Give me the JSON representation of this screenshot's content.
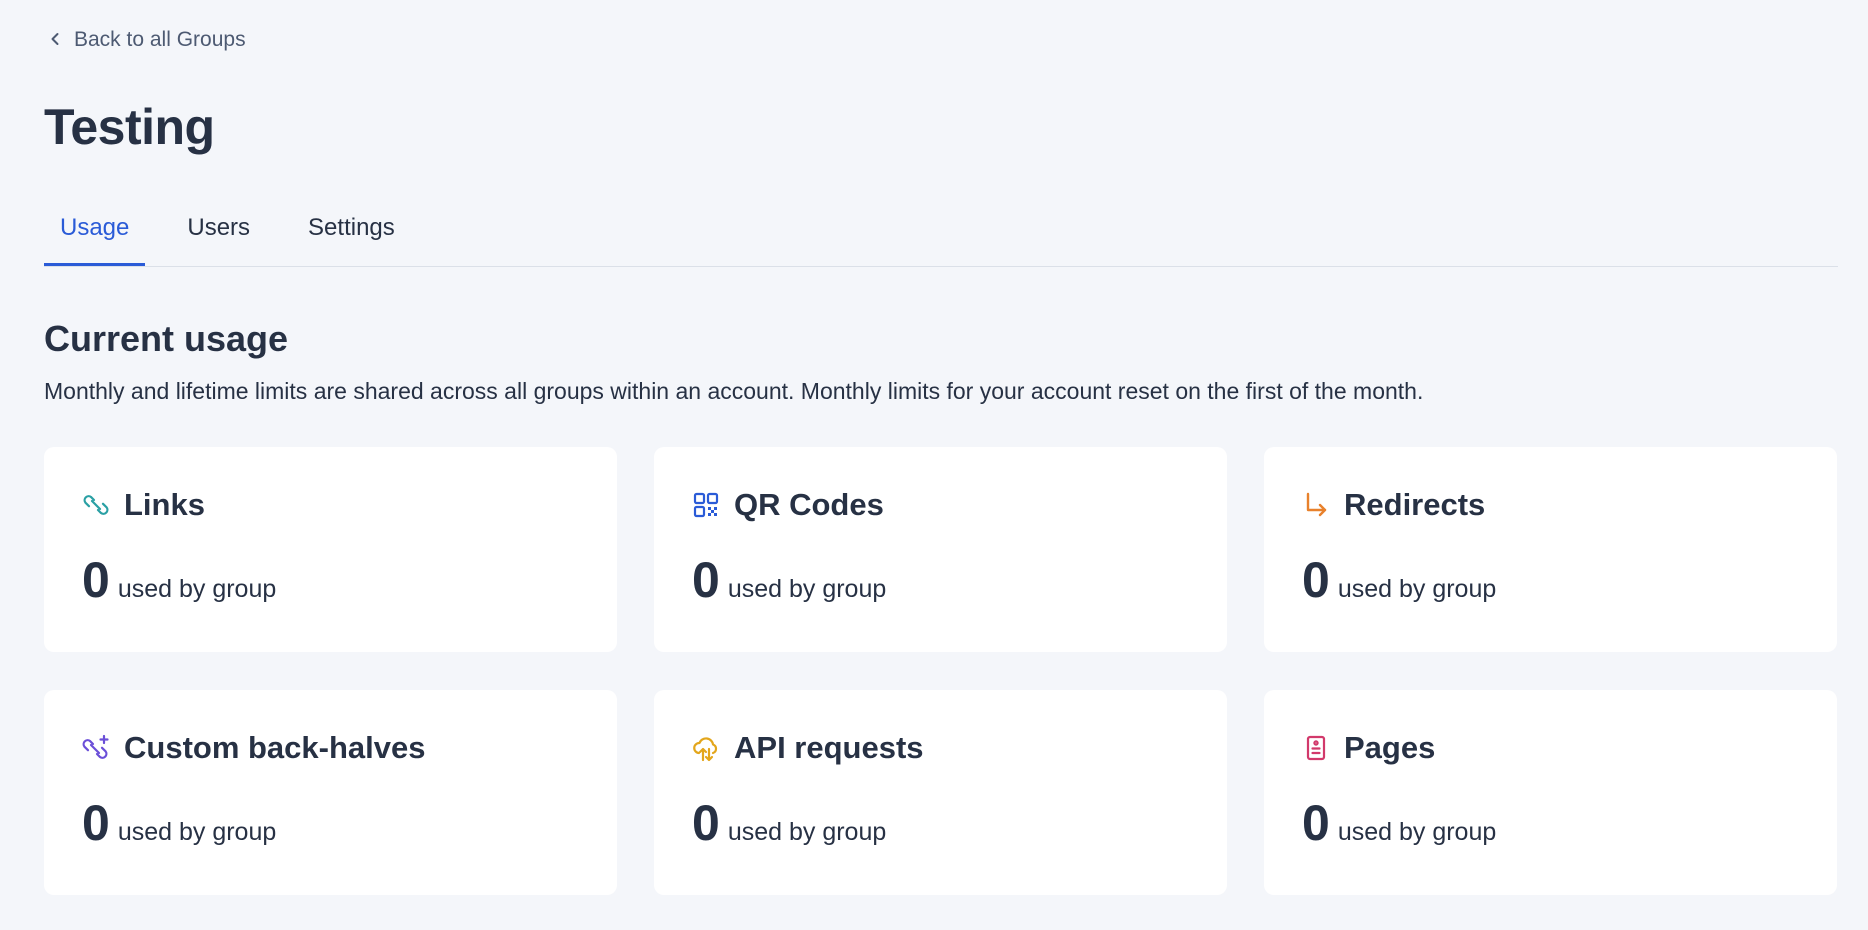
{
  "back_link": {
    "label": "Back to all Groups"
  },
  "page_title": "Testing",
  "tabs": [
    {
      "label": "Usage",
      "active": true
    },
    {
      "label": "Users",
      "active": false
    },
    {
      "label": "Settings",
      "active": false
    }
  ],
  "section": {
    "title": "Current usage",
    "description": "Monthly and lifetime limits are shared across all groups within an account. Monthly limits for your account reset on the first of the month."
  },
  "cards": [
    {
      "title": "Links",
      "value": "0",
      "label": "used by group",
      "icon": "link-icon",
      "color": "#2aa0a4"
    },
    {
      "title": "QR Codes",
      "value": "0",
      "label": "used by group",
      "icon": "qr-code-icon",
      "color": "#2a5bd7"
    },
    {
      "title": "Redirects",
      "value": "0",
      "label": "used by group",
      "icon": "redirect-arrow-icon",
      "color": "#e8812c"
    },
    {
      "title": "Custom back-halves",
      "value": "0",
      "label": "used by group",
      "icon": "custom-link-icon",
      "color": "#6b4fd8"
    },
    {
      "title": "API requests",
      "value": "0",
      "label": "used by group",
      "icon": "cloud-transfer-icon",
      "color": "#e3a61c"
    },
    {
      "title": "Pages",
      "value": "0",
      "label": "used by group",
      "icon": "page-icon",
      "color": "#d2396b"
    }
  ],
  "colors": {
    "accent": "#2a5bd7",
    "background": "#f4f6fa",
    "text": "#273144"
  }
}
